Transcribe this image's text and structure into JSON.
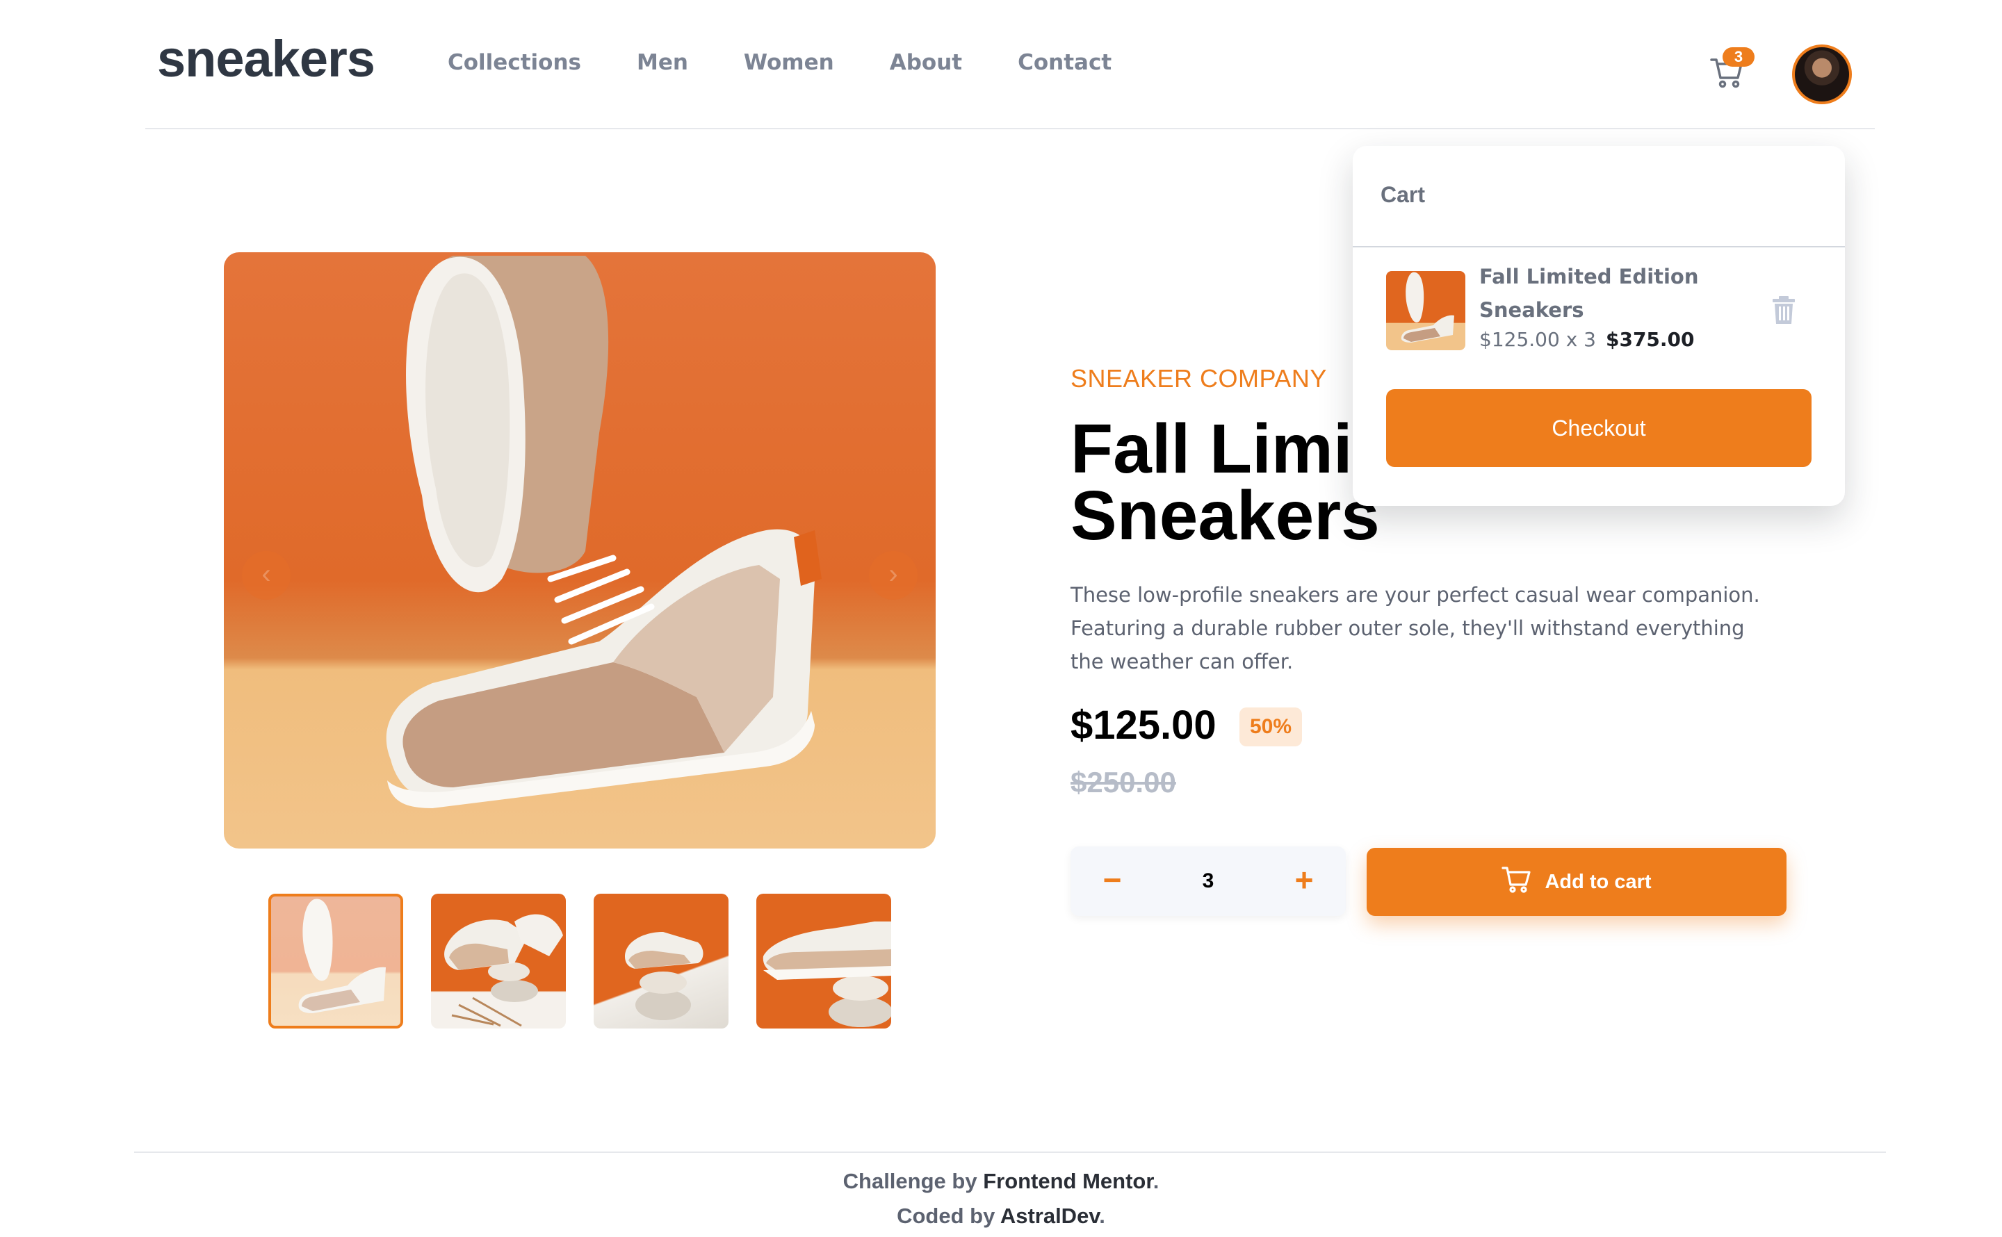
{
  "header": {
    "logo": "sneakers",
    "nav": [
      "Collections",
      "Men",
      "Women",
      "About",
      "Contact"
    ],
    "cart_count": "3"
  },
  "product": {
    "company": "SNEAKER COMPANY",
    "title": "Fall Limited Edition Sneakers",
    "description": "These low-profile sneakers are your perfect casual wear companion. Featuring a durable rubber outer sole, they'll withstand everything the weather can offer.",
    "price": "$125.00",
    "discount": "50%",
    "old_price": "$250.00",
    "quantity": "3",
    "minus_label": "−",
    "plus_label": "+",
    "add_to_cart_label": "Add to cart"
  },
  "gallery": {
    "prev_label": "‹",
    "next_label": "›"
  },
  "cart": {
    "heading": "Cart",
    "item_name": "Fall Limited Edition Sneakers",
    "item_calc": "$125.00 x 3",
    "item_total": "$375.00",
    "checkout_label": "Checkout"
  },
  "footer": {
    "line1_prefix": "Challenge by",
    "line1_link": "Frontend Mentor",
    "line2_prefix": "Coded by",
    "line2_link": "AstralDev"
  },
  "colors": {
    "accent": "#ee7d1c",
    "accent_light": "#fde9d7",
    "dark": "#1d2026",
    "muted": "#69707d"
  },
  "icons": [
    "cart-icon",
    "avatar",
    "trash-icon",
    "prev-arrow-icon",
    "next-arrow-icon",
    "minus-icon",
    "plus-icon"
  ]
}
